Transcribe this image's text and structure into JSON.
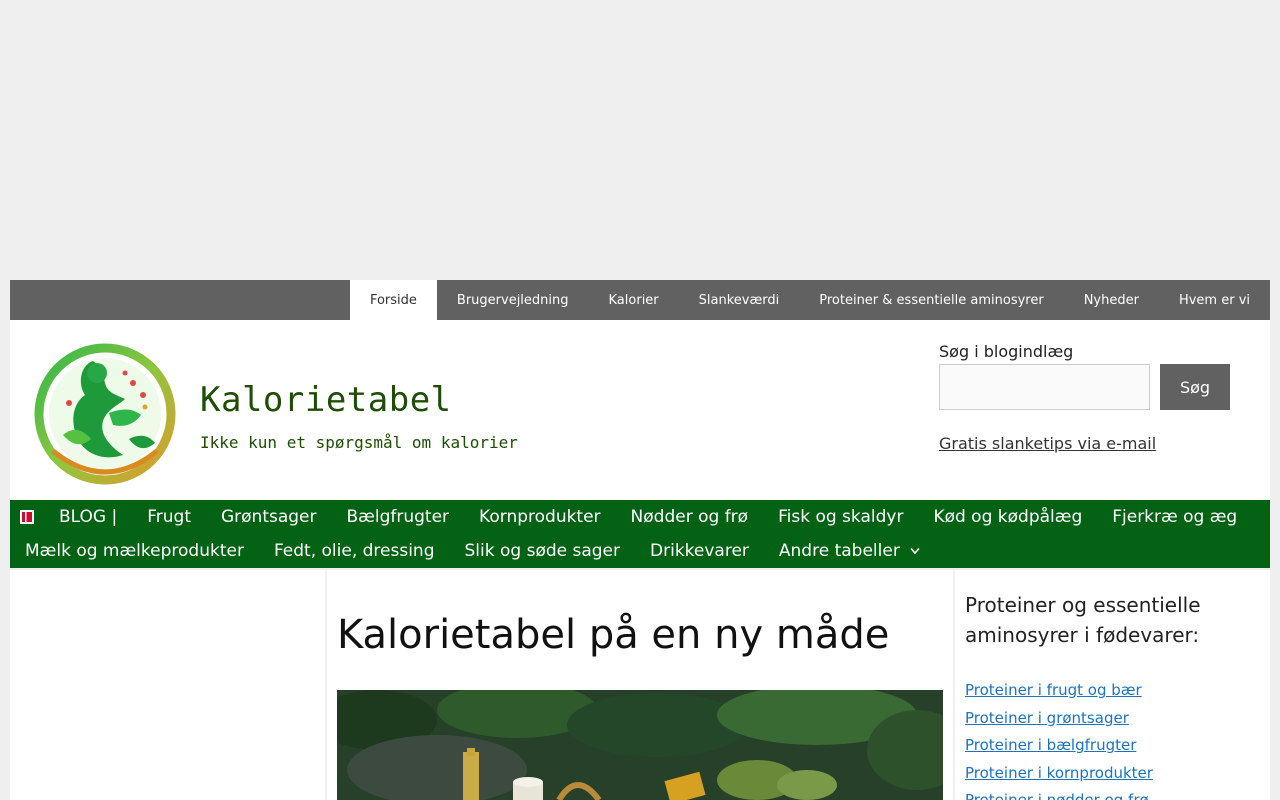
{
  "top_nav": {
    "items": [
      "Forside",
      "Brugervejledning",
      "Kalorier",
      "Slankeværdi",
      "Proteiner & essentielle aminosyrer",
      "Nyheder",
      "Hvem er vi"
    ]
  },
  "header": {
    "title": "Kalorietabel",
    "tagline": "Ikke kun et spørgsmål om kalorier",
    "search_label": "Søg i blogindlæg",
    "search_value": "",
    "search_button": "Søg",
    "email_link": "Gratis slanketips via e-mail"
  },
  "main_nav": {
    "row1": [
      "BLOG |",
      "Frugt",
      "Grøntsager",
      "Bælgfrugter",
      "Kornprodukter",
      "Nødder og frø",
      "Fisk og skaldyr",
      "Kød og kødpålæg",
      "Fjerkræ og æg"
    ],
    "row2": [
      "Mælk og mælkeprodukter",
      "Fedt, olie, dressing",
      "Slik og søde sager",
      "Drikkevarer",
      "Andre tabeller"
    ]
  },
  "main": {
    "title": "Kalorietabel på en ny måde"
  },
  "sidebar": {
    "heading": "Proteiner og essentielle aminosyrer i fødevarer:",
    "links": [
      "Proteiner i frugt og bær",
      "Proteiner i grøntsager",
      "Proteiner i bælgfrugter",
      "Proteiner i kornprodukter",
      "Proteiner i nødder og frø"
    ]
  },
  "colors": {
    "top_nav_bg": "#616161",
    "main_nav_bg": "#046215",
    "title_green": "#1e4d06",
    "link_blue": "#1e73be"
  }
}
